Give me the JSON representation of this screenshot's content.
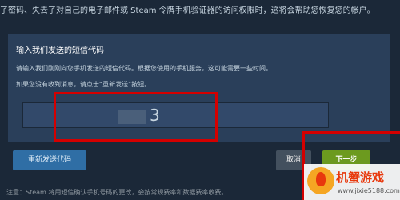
{
  "intro_text": "了密码、失去了对自己的电子邮件或 Steam 令牌手机验证器的访问权限时，这将会帮助您恢复您的帐户。",
  "panel": {
    "title": "输入我们发送的短信代码",
    "instruction_1": "请输入我们刚刚向您手机发送的短信代码。根据您使用的手机服务，这可能需要一些时间。",
    "instruction_2": "如果您没有收到消息，请点击“重新发送”按钮。",
    "code_value": "3"
  },
  "buttons": {
    "resend_label": "重新发送代码",
    "cancel_label": "取消",
    "next_label": "下一步"
  },
  "note_text": "注意：Steam 将用短信确认手机号码的更改，会按常规费率和数据费率收费。",
  "watermark": {
    "brand": "机蟹游戏",
    "url": "www.jixie5188.com"
  },
  "colors": {
    "background": "#1b2838",
    "panel": "#2a3f5a",
    "highlight_red": "#d40000",
    "next_green": "#6c9a1f",
    "resend_blue": "#2f6ea5"
  }
}
